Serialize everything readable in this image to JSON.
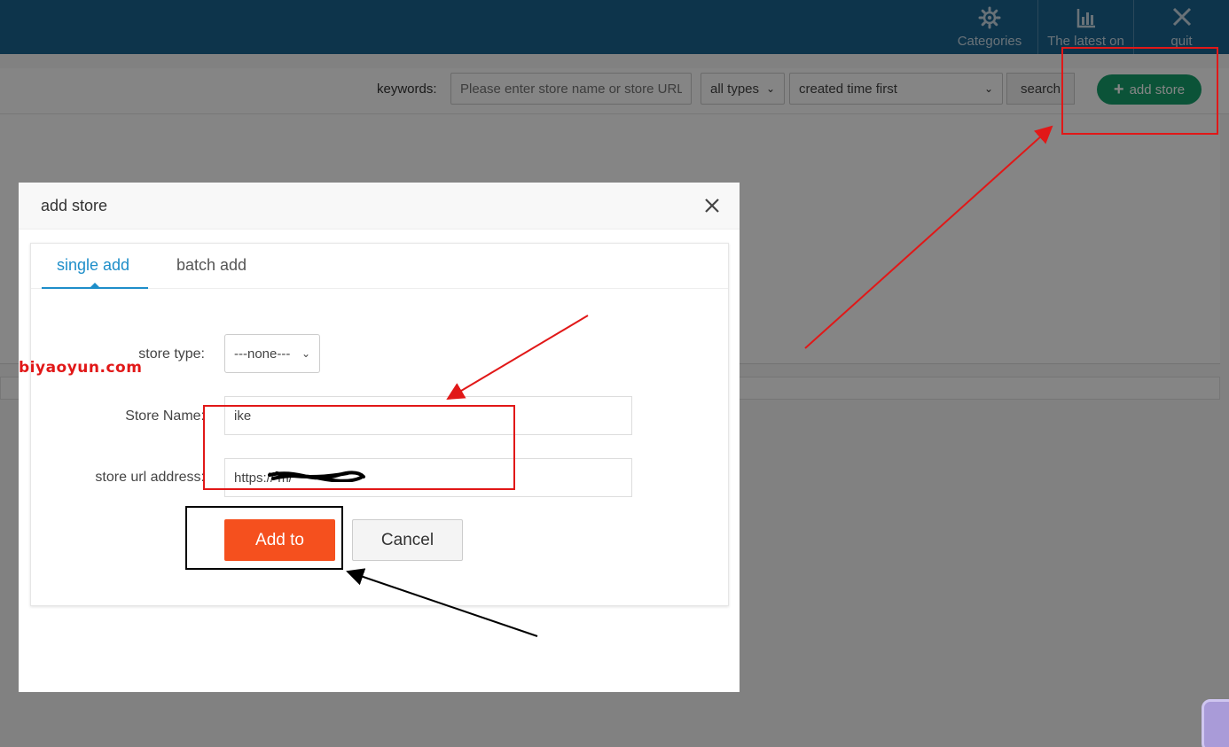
{
  "topnav": {
    "items": [
      {
        "label": "Categories",
        "icon": "gear-icon"
      },
      {
        "label": "The latest on",
        "icon": "bar-chart-icon"
      },
      {
        "label": "quit",
        "icon": "close-icon"
      }
    ]
  },
  "toolbar": {
    "keywords_label": "keywords:",
    "search_placeholder": "Please enter store name or store URL",
    "type_select": "all types",
    "sort_select": "created time first",
    "search_button": "search",
    "add_store_button": "add store"
  },
  "modal": {
    "title": "add store",
    "tabs": [
      {
        "label": "single add",
        "active": true
      },
      {
        "label": "batch add",
        "active": false
      }
    ],
    "form": {
      "store_type_label": "store type:",
      "store_type_value": "---none---",
      "store_name_label": "Store Name:",
      "store_name_value": "ike",
      "store_url_label": "store url address:",
      "store_url_value": "https://                    m/",
      "add_button": "Add to",
      "cancel_button": "Cancel"
    }
  },
  "watermark": "biyaoyun.com",
  "colors": {
    "topbar": "#1a6491",
    "accent": "#1e8ec9",
    "add_store_green": "#16a06b",
    "primary_button": "#f5501e",
    "annotation_red": "#e11818",
    "annotation_black": "#000000"
  }
}
